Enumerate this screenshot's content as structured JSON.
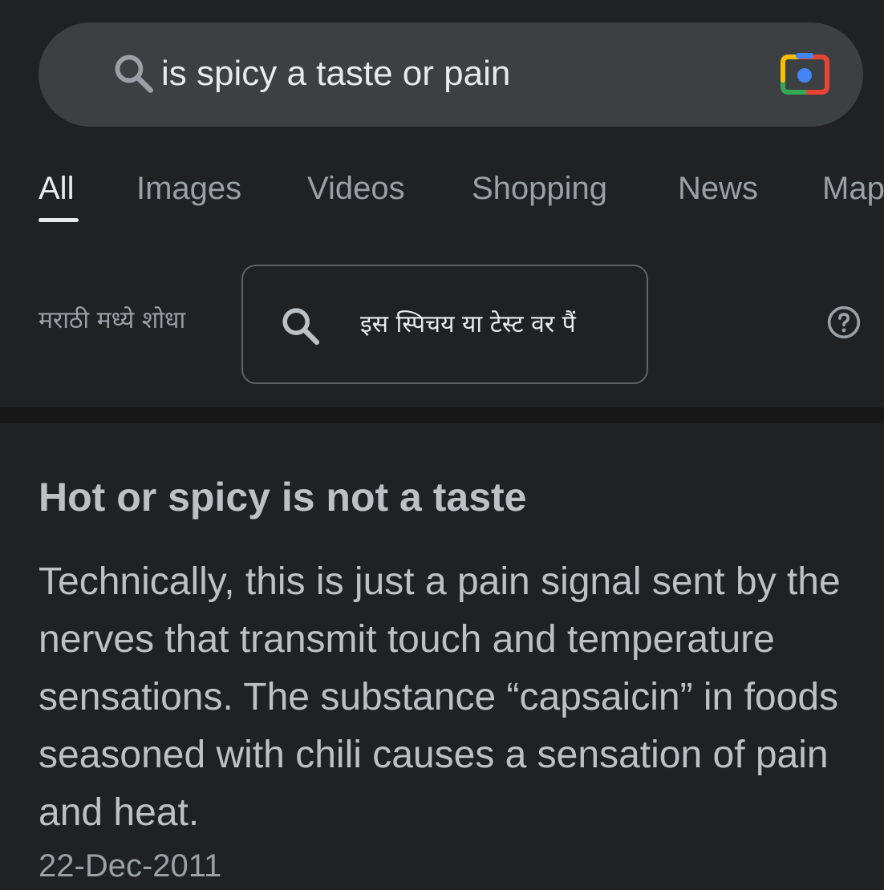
{
  "search": {
    "query": "is spicy a taste or pain"
  },
  "tabs": [
    {
      "label": "All",
      "active": true
    },
    {
      "label": "Images",
      "active": false
    },
    {
      "label": "Videos",
      "active": false
    },
    {
      "label": "Shopping",
      "active": false
    },
    {
      "label": "News",
      "active": false
    },
    {
      "label": "Maps",
      "active": false
    }
  ],
  "translate": {
    "label": "मराठी मध्ये शोधा",
    "suggestion": "इस स्पिचय या टेस्ट वर पैं"
  },
  "answer": {
    "title": "Hot or spicy is not a taste",
    "body": "Technically, this is just a pain signal sent by the nerves that transmit touch and temperature sensations. The substance “capsaicin” in foods seasoned with chili causes a sensation of pain and heat.",
    "date": "22-Dec-2011"
  },
  "colors": {
    "background": "#202124",
    "search_bar": "#3c4043",
    "text_primary": "#e8eaed",
    "text_secondary": "#9aa0a6",
    "divider": "#171717"
  },
  "icons": {
    "search": "search-icon",
    "lens": "google-lens-icon",
    "help": "help-circle-icon"
  }
}
